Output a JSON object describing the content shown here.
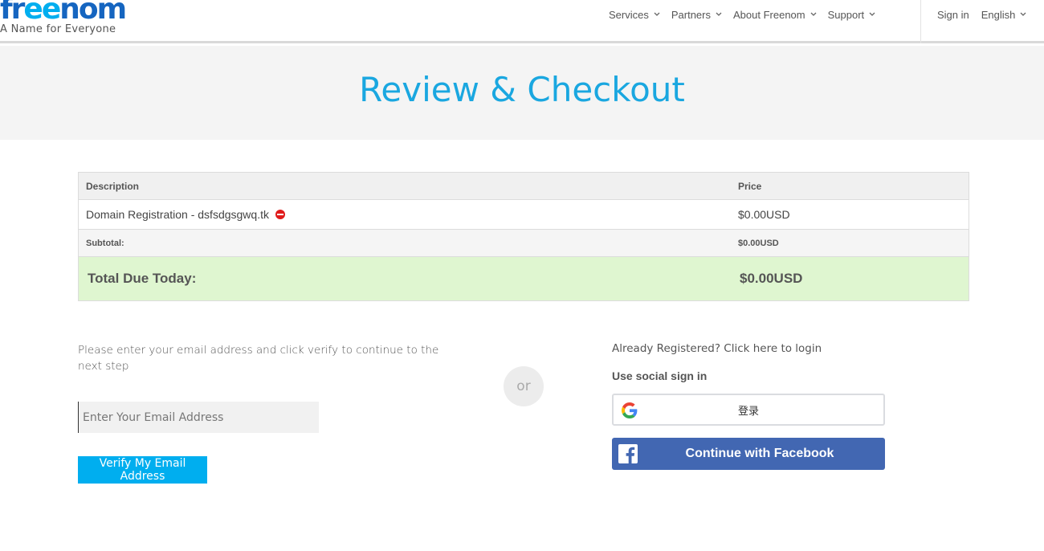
{
  "header": {
    "logo_part1": "fr",
    "logo_part2": "ee",
    "logo_part3": "nom",
    "tagline": "A Name for Everyone",
    "nav": [
      {
        "label": "Services"
      },
      {
        "label": "Partners"
      },
      {
        "label": "About Freenom"
      },
      {
        "label": "Support"
      }
    ],
    "sign_in": "Sign in",
    "language": "English"
  },
  "hero": {
    "title": "Review & Checkout"
  },
  "order": {
    "col_description": "Description",
    "col_price": "Price",
    "item_description": "Domain Registration - dsfsdgsgwq.tk",
    "item_price": "$0.00USD",
    "subtotal_label": "Subtotal:",
    "subtotal_value": "$0.00USD",
    "total_label": "Total Due Today:",
    "total_value": "$0.00USD"
  },
  "email_step": {
    "instructions": "Please enter your email address and click verify to continue to the next step",
    "placeholder": "Enter Your Email Address",
    "verify_label": "Verify My Email Address"
  },
  "or_label": "or",
  "login": {
    "link": "Already Registered? Click here to login",
    "social_title": "Use social sign in",
    "google_label": "登录",
    "facebook_label": "Continue with Facebook"
  },
  "colors": {
    "accent": "#00aeef",
    "logo_blue": "#1565c0",
    "total_bg": "#dff6d0",
    "facebook": "#4267b2",
    "remove": "#e01b1b"
  }
}
